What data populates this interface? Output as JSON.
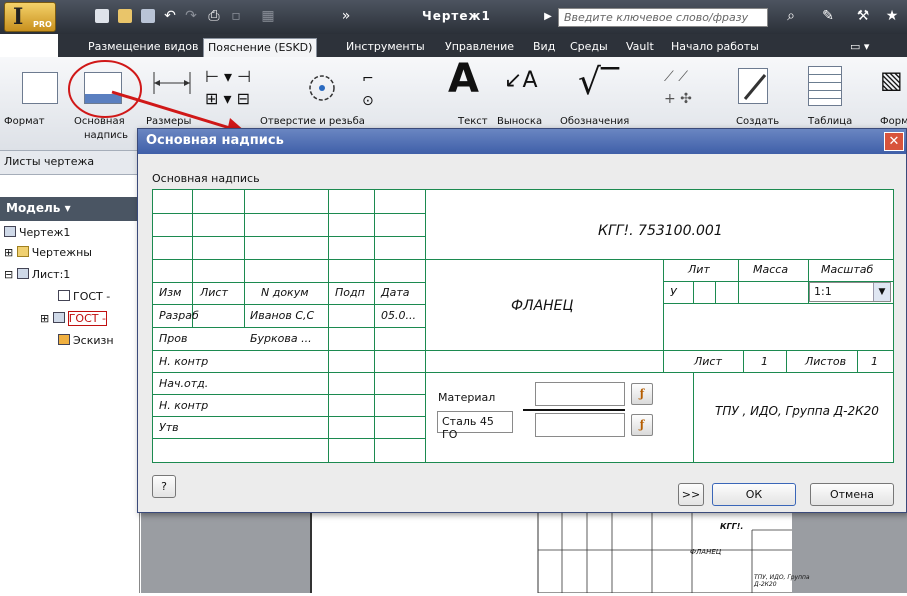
{
  "window": {
    "title": "Чертеж1",
    "search_placeholder": "Введите ключевое слово/фразу",
    "pro_badge": "PRO"
  },
  "tabs": [
    {
      "label": "Размещение видов"
    },
    {
      "label": "Пояснение (ESKD)"
    },
    {
      "label": "Инструменты"
    },
    {
      "label": "Управление"
    },
    {
      "label": "Вид"
    },
    {
      "label": "Среды"
    },
    {
      "label": "Vault"
    },
    {
      "label": "Начало работы"
    }
  ],
  "ribbon": {
    "format": "Формат",
    "title_block_line1": "Основная",
    "title_block_line2": "надпись",
    "dimensions": "Размеры",
    "holes": "Отверстие и резьба",
    "text": "Текст",
    "leader": "Выноска",
    "symbols": "Обозначения",
    "create": "Создать",
    "table": "Таблица",
    "form": "Форм",
    "text_glyph": "A",
    "leader_glyph": "A",
    "panel_title": "Листы чертежа"
  },
  "browser": {
    "header": "Модель ▾",
    "items": [
      {
        "label": "Чертеж1"
      },
      {
        "label": "Чертежны"
      },
      {
        "label": "Лист:1"
      },
      {
        "label": "ГОСТ -"
      },
      {
        "label": "ГОСТ -"
      },
      {
        "label": "Эскизн"
      }
    ]
  },
  "dialog": {
    "title": "Основная надпись",
    "section_label": "Основная надпись",
    "designation": "КГГ!. 753100.001",
    "part_name": "ФЛАНЕЦ",
    "headers": {
      "izm": "Изм",
      "list": "Лист",
      "ndokum": "N докум",
      "podp": "Подп",
      "data": "Дата"
    },
    "rows": [
      {
        "role": "Разраб",
        "name": "Иванов С,С",
        "date": "05.0..."
      },
      {
        "role": "Пров",
        "name": "Буркова ...",
        "date": ""
      },
      {
        "role": "Н. контр",
        "name": "",
        "date": ""
      },
      {
        "role": "Нач.отд.",
        "name": "",
        "date": ""
      },
      {
        "role": "Н. контр",
        "name": "",
        "date": ""
      },
      {
        "role": "Утв",
        "name": "",
        "date": ""
      }
    ],
    "lit_header": "Лит",
    "mass_header": "Масса",
    "scale_header": "Масштаб",
    "lit_value": "У",
    "scale_value": "1:1",
    "sheet_label": "Лист",
    "sheet_value": "1",
    "sheets_label": "Листов",
    "sheets_value": "1",
    "material_label": "Материал",
    "material_value": "Сталь 45 ГО",
    "organization": "ТПУ , ИДО, Группа Д-2К20",
    "buttons": {
      "more": ">>",
      "ok": "ОК",
      "cancel": "Отмена",
      "help": "?"
    }
  },
  "drawing_preview": {
    "code": "КГГ!.",
    "name": "ФЛАНЕЦ",
    "org": "ТПУ, ИДО, Группа Д-2К20"
  },
  "colors": {
    "grid_green": "#1c8a50",
    "dialog_title": "#4a6ab4",
    "highlight_red": "#d01818"
  }
}
